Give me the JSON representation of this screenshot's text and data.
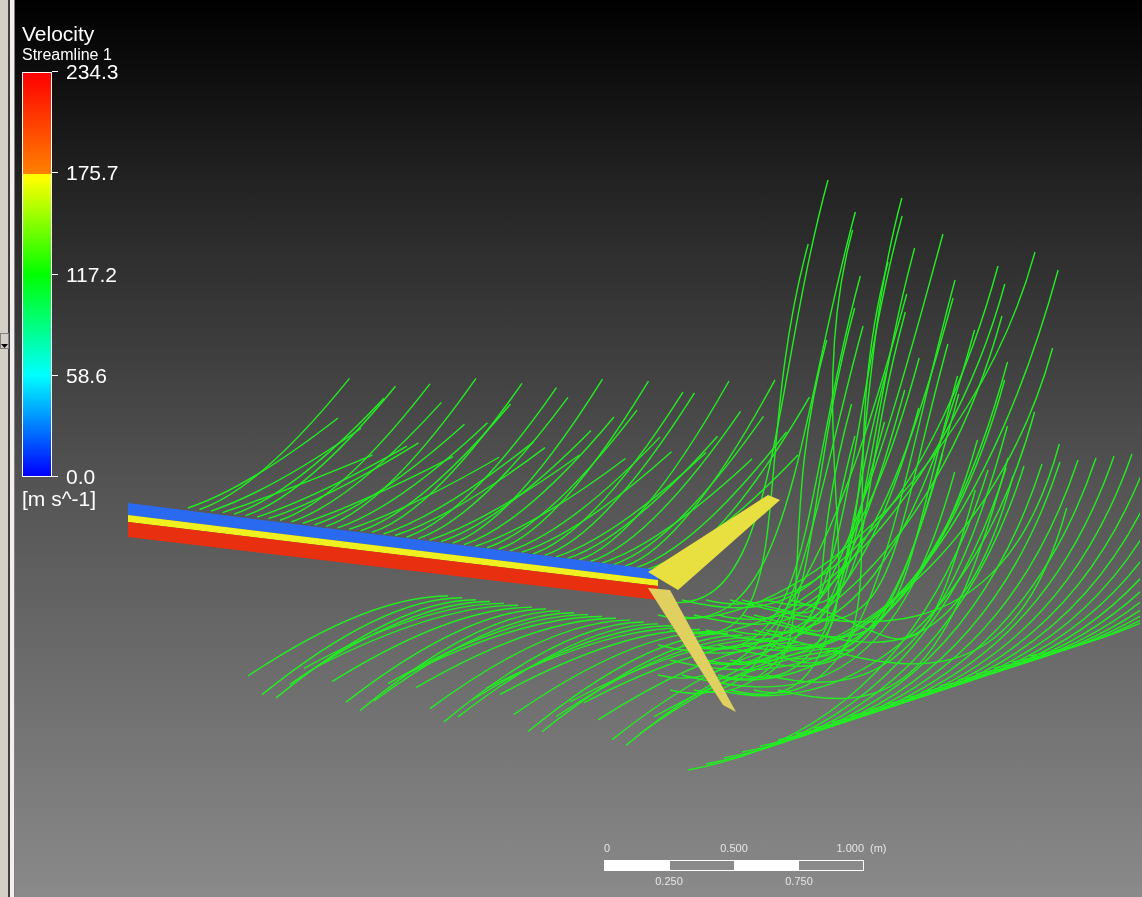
{
  "legend": {
    "title": "Velocity",
    "subtitle": "Streamline 1",
    "labels": [
      "234.3",
      "175.7",
      "117.2",
      "58.6",
      "0.0"
    ],
    "units": "[m s^-1]"
  },
  "scale_bar": {
    "top_labels": [
      "0",
      "0.500",
      "1.000"
    ],
    "unit": "(m)",
    "bottom_labels": [
      "0.250",
      "0.750"
    ]
  }
}
